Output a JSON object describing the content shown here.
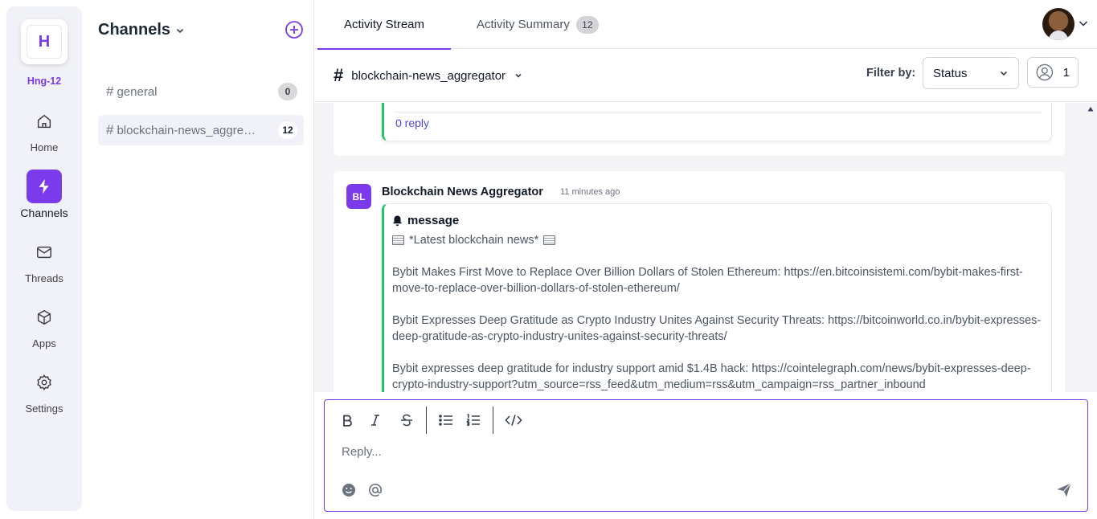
{
  "workspace": {
    "initial": "H",
    "name": "Hng-12"
  },
  "nav": [
    {
      "label": "Home",
      "icon": "home-icon"
    },
    {
      "label": "Channels",
      "icon": "lightning-icon"
    },
    {
      "label": "Threads",
      "icon": "mail-icon"
    },
    {
      "label": "Apps",
      "icon": "cube-icon"
    },
    {
      "label": "Settings",
      "icon": "gear-icon"
    }
  ],
  "channels": {
    "title": "Channels",
    "items": [
      {
        "name": "general",
        "count": "0"
      },
      {
        "name": "blockchain-news_aggregator",
        "count": "12"
      }
    ]
  },
  "tabs": {
    "stream": "Activity Stream",
    "summary": "Activity Summary",
    "summary_count": "12"
  },
  "toolbar": {
    "channel": "blockchain-news_aggregator",
    "filter_label": "Filter by:",
    "filter_value": "Status",
    "member_count": "1"
  },
  "stream": {
    "prev_reply": "0 reply",
    "message": {
      "avatar": "BL",
      "sender": "Blockchain News Aggregator",
      "time": "11 minutes ago",
      "type": "message",
      "headline": "*Latest blockchain news*",
      "items": [
        "Bybit Makes First Move to Replace Over Billion Dollars of Stolen Ethereum: https://en.bitcoinsistemi.com/bybit-makes-first-move-to-replace-over-billion-dollars-of-stolen-ethereum/",
        "Bybit Expresses Deep Gratitude as Crypto Industry Unites Against Security Threats: https://bitcoinworld.co.in/bybit-expresses-deep-gratitude-as-crypto-industry-unites-against-security-threats/",
        "Bybit expresses deep gratitude for industry support amid $1.4B hack: https://cointelegraph.com/news/bybit-expresses-deep-crypto-industry-support?utm_source=rss_feed&utm_medium=rss&utm_campaign=rss_partner_inbound"
      ]
    }
  },
  "composer": {
    "placeholder": "Reply..."
  },
  "colors": {
    "accent": "#7c3aed",
    "thread_bar": "#22c55e",
    "link": "#4f46e5"
  }
}
